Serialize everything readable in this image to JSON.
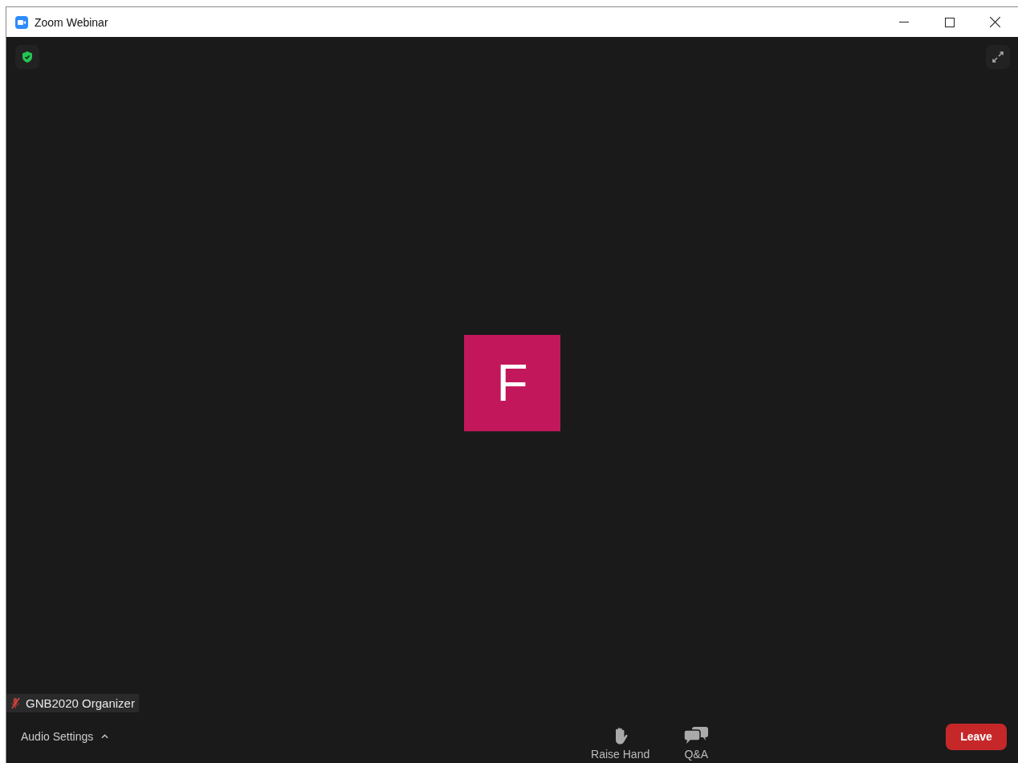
{
  "window": {
    "title": "Zoom Webinar"
  },
  "video": {
    "avatar_letter": "F",
    "color": "#c2185b"
  },
  "name_tag": {
    "name": "GNB2020 Organizer",
    "muted": true
  },
  "toolbar": {
    "audio_settings": "Audio Settings",
    "actions": [
      {
        "kind": "hand",
        "label": "Raise Hand"
      },
      {
        "kind": "chat",
        "label": "Q&A"
      }
    ],
    "leave": "Leave"
  }
}
